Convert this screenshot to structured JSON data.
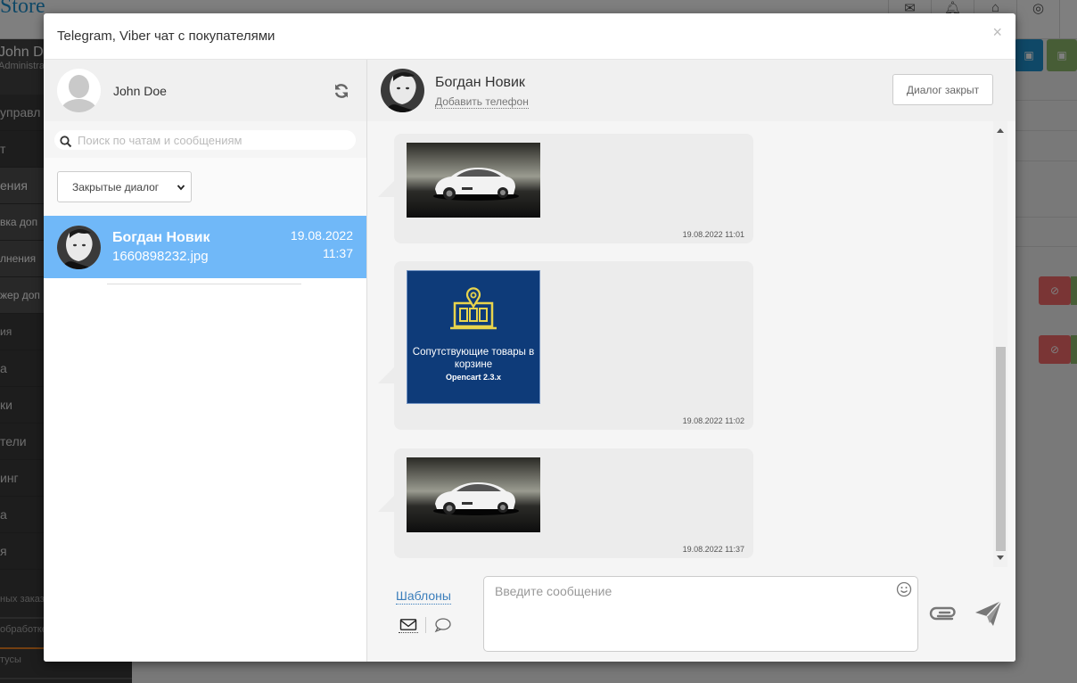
{
  "background": {
    "logo_text": "Store",
    "user": {
      "name": "John Doe",
      "role": "Administrator"
    },
    "nav": [
      "управл",
      "т",
      "ения",
      "вка доп",
      "лнения",
      "жер доп",
      "ия",
      "а",
      "ки",
      "тели",
      "инг",
      "а",
      "я"
    ],
    "stats": [
      "ных заказ",
      "обработке",
      "тусы"
    ]
  },
  "modal": {
    "title": "Telegram, Viber чат с покупателями",
    "close_symbol": "×"
  },
  "me": {
    "name": "John Doe"
  },
  "search": {
    "placeholder": "Поиск по чатам и сообщениям"
  },
  "filter": {
    "selected": "Закрытые диалог"
  },
  "chats": [
    {
      "name": "Богдан Новик",
      "preview": "1660898232.jpg",
      "date": "19.08.2022",
      "time": "11:37"
    }
  ],
  "contact": {
    "name": "Богдан Новик",
    "add_phone": "Добавить телефон",
    "dialog_button": "Диалог закрыт"
  },
  "messages": [
    {
      "type": "image",
      "image": "bmw-car",
      "time": "19.08.2022 11:01"
    },
    {
      "type": "image",
      "image": "banner",
      "banner_title": "Сопутствующие товары в корзине",
      "banner_sub": "Opencart 2.3.x",
      "time": "19.08.2022 11:02"
    },
    {
      "type": "image",
      "image": "bmw-car",
      "time": "19.08.2022 11:37"
    }
  ],
  "composer": {
    "templates_label": "Шаблоны",
    "placeholder": "Введите сообщение"
  },
  "colors": {
    "accent": "#70b8f8",
    "link": "#3a7dbb",
    "banner_bg": "#0e3b79",
    "banner_icon": "#e8d44d"
  }
}
